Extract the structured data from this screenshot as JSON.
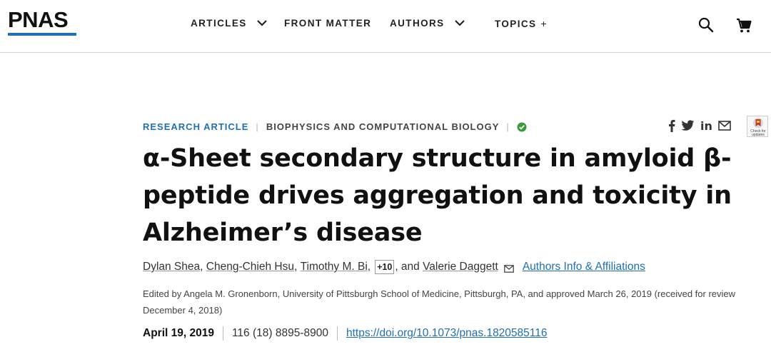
{
  "header": {
    "logo_text": "PNAS",
    "nav": [
      {
        "label": "ARTICLES",
        "icon": "chevron-down-icon"
      },
      {
        "label": "FRONT MATTER"
      },
      {
        "label": "AUTHORS",
        "icon": "chevron-down-icon"
      },
      {
        "label": "TOPICS",
        "icon": "plus-icon",
        "icon_glyph": "+"
      }
    ],
    "actions": [
      "search-icon",
      "cart-icon"
    ]
  },
  "article": {
    "type": "RESEARCH ARTICLE",
    "separator": "|",
    "subject": "BIOPHYSICS AND COMPUTATIONAL BIOLOGY",
    "status_icon": "check-circle-icon",
    "title": "α-Sheet secondary structure in amyloid β-peptide drives aggregation and toxicity in Alzheimer’s disease",
    "authors": {
      "list": [
        "Dylan Shea",
        "Cheng-Chieh Hsu",
        "Timothy M. Bi"
      ],
      "comma": ",",
      "more_label": "+10",
      "and_text": ", and",
      "last": "Valerie Daggett",
      "affiliations_link": "Authors Info & Affiliations"
    },
    "edited_by": "Edited by Angela M. Gronenborn, University of Pittsburgh School of Medicine, Pittsburgh, PA, and approved March 26, 2019 (received for review December 4, 2018)",
    "pub_date": "April 19, 2019",
    "citation": "116 (18) 8895-8900",
    "doi": "https://doi.org/10.1073/pnas.1820585116"
  },
  "share": {
    "icons": [
      "facebook-icon",
      "twitter-icon",
      "linkedin-icon",
      "email-icon"
    ],
    "linkedin_glyph": "in",
    "facebook_glyph": "f",
    "check_updates_label": "Check for updates"
  },
  "colors": {
    "brand_blue": "#1f6fb5",
    "verified_green": "#3a9b3a",
    "text_dark": "#111111"
  }
}
